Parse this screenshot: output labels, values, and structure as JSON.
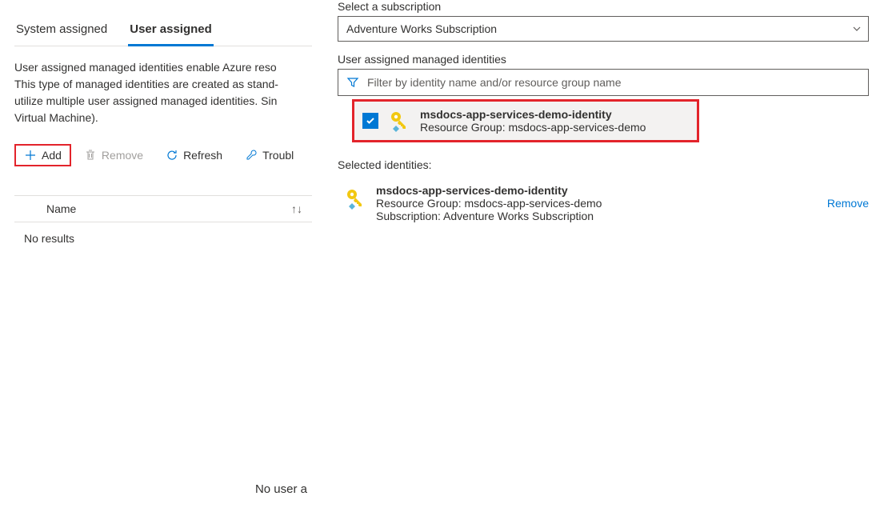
{
  "tabs": {
    "system": "System assigned",
    "user": "User assigned"
  },
  "description": "User assigned managed identities enable Azure reso\nThis type of managed identities are created as stand-\nutilize multiple user assigned managed identities. Sin\nVirtual Machine).",
  "actions": {
    "add": "Add",
    "remove": "Remove",
    "refresh": "Refresh",
    "troubleshoot": "Troubl"
  },
  "table": {
    "col_name": "Name",
    "no_results": "No results",
    "no_user": "No user a"
  },
  "flyout": {
    "subscription_label": "Select a subscription",
    "subscription_value": "Adventure Works Subscription",
    "identities_label": "User assigned managed identities",
    "filter_placeholder": "Filter by identity name and/or resource group name",
    "identity": {
      "name": "msdocs-app-services-demo-identity",
      "rg": "Resource Group: msdocs-app-services-demo"
    },
    "selected_label": "Selected identities:",
    "selected": {
      "name": "msdocs-app-services-demo-identity",
      "rg": "Resource Group: msdocs-app-services-demo",
      "sub": "Subscription: Adventure Works Subscription",
      "remove": "Remove"
    }
  }
}
